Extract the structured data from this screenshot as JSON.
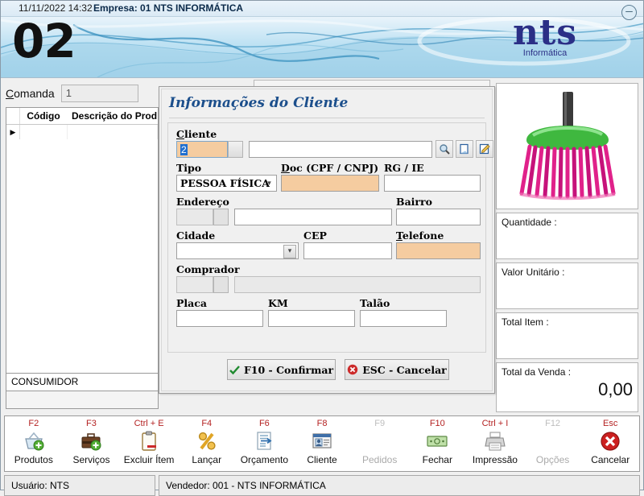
{
  "header": {
    "datetime": "11/11/2022 14:32",
    "company": "Empresa: 01 NTS INFORMÁTICA",
    "terminal_number": "02",
    "logo_main": "nts",
    "logo_sub": "Informática",
    "minimize_icon": "minimize-icon"
  },
  "left": {
    "comanda_label": "Comanda",
    "comanda_value": "1",
    "grid_headers": [
      "Código",
      "Descrição do Prod"
    ],
    "rows": [],
    "row_marker": "▶",
    "consumidor": "CONSUMIDOR"
  },
  "dialog": {
    "title": "Informações do Cliente",
    "fields": {
      "cliente_label": "Cliente",
      "cliente_code": "2",
      "cliente_name": "",
      "tipo_label": "Tipo",
      "tipo_value": "PESSOA FÍSICA",
      "doc_label": "Doc (CPF / CNPJ)",
      "doc_value": "",
      "rg_label": "RG / IE",
      "rg_value": "",
      "endereco_label": "Endereço",
      "endereco_code": "",
      "endereco_value": "",
      "bairro_label": "Bairro",
      "bairro_value": "",
      "cidade_label": "Cidade",
      "cidade_value": "",
      "cep_label": "CEP",
      "cep_value": "",
      "telefone_label": "Telefone",
      "telefone_value": "",
      "comprador_label": "Comprador",
      "comprador_code": "",
      "comprador_value": "",
      "placa_label": "Placa",
      "placa_value": "",
      "km_label": "KM",
      "km_value": "",
      "talao_label": "Talão",
      "talao_value": ""
    },
    "icons": {
      "search": "search-icon",
      "copy": "copy-icon",
      "edit": "edit-icon"
    },
    "buttons": {
      "confirm": "F10 - Confirmar",
      "cancel": "ESC - Cancelar"
    }
  },
  "right": {
    "product_image": "broom-product-image",
    "quantidade_label": "Quantidade :",
    "quantidade_value": "",
    "valor_unitario_label": "Valor Unitário :",
    "valor_unitario_value": "",
    "total_item_label": "Total Item :",
    "total_item_value": "",
    "total_venda_label": "Total da Venda :",
    "total_venda_value": "0,00"
  },
  "toolbar": [
    {
      "key": "F2",
      "label": "Produtos",
      "icon": "basket-add-icon",
      "disabled": false
    },
    {
      "key": "F3",
      "label": "Serviços",
      "icon": "briefcase-add-icon",
      "disabled": false
    },
    {
      "key": "Ctrl + E",
      "label": "Excluir Ítem",
      "icon": "clipboard-icon",
      "disabled": false
    },
    {
      "key": "F4",
      "label": "Lançar",
      "icon": "percent-icon",
      "disabled": false
    },
    {
      "key": "F6",
      "label": "Orçamento",
      "icon": "document-arrow-icon",
      "disabled": false
    },
    {
      "key": "F8",
      "label": "Cliente",
      "icon": "id-card-icon",
      "disabled": false
    },
    {
      "key": "F9",
      "label": "Pedidos",
      "icon": "none",
      "disabled": true
    },
    {
      "key": "F10",
      "label": "Fechar",
      "icon": "money-icon",
      "disabled": false
    },
    {
      "key": "Ctrl + I",
      "label": "Impressão",
      "icon": "printer-icon",
      "disabled": false
    },
    {
      "key": "F12",
      "label": "Opções",
      "icon": "none",
      "disabled": true
    },
    {
      "key": "Esc",
      "label": "Cancelar",
      "icon": "cancel-icon",
      "disabled": false
    }
  ],
  "status": {
    "usuario": "Usuário: NTS",
    "vendedor": "Vendedor: 001 - NTS INFORMÁTICA"
  },
  "colors": {
    "header_blue": "#a9d8ef",
    "logo_navy": "#2b2f86",
    "dialog_title_blue": "#1c4f8c",
    "key_red": "#b42222",
    "required_orange": "#f5cca0",
    "selection_blue": "#1f6fd0"
  }
}
